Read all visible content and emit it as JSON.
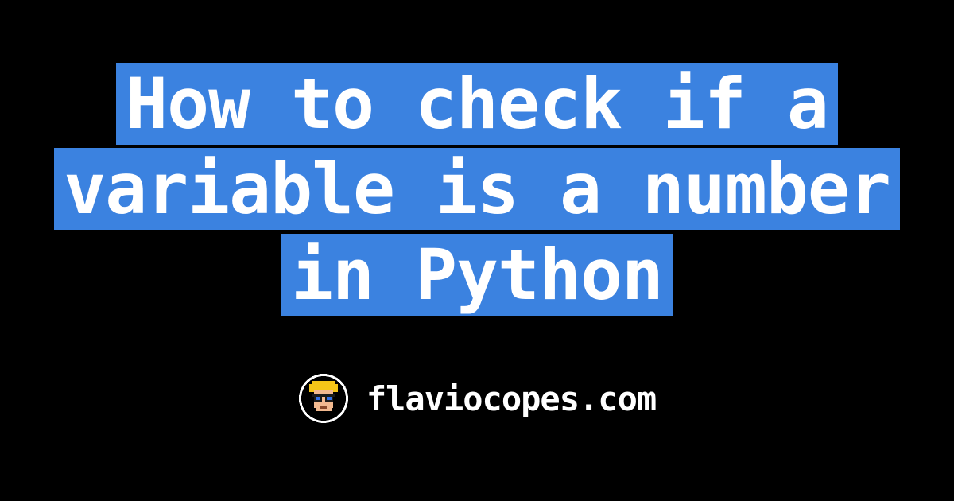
{
  "title": "How to check if a variable is a number in Python",
  "site": "flaviocopes.com",
  "colors": {
    "background": "#000000",
    "highlight": "#3b82e0",
    "text": "#ffffff"
  }
}
